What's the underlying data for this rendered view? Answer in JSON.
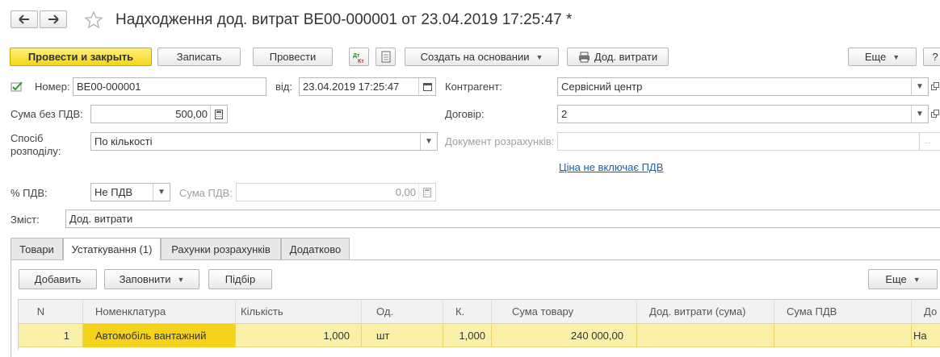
{
  "title": "Надходження дод. витрат ВЕ00-000001 от 23.04.2019 17:25:47 *",
  "toolbar": {
    "post_close": "Провести и закрыть",
    "save": "Записать",
    "post": "Провести",
    "create_based": "Создать на основании",
    "additional_costs": "Дод. витрати",
    "more": "Еще",
    "help": "?"
  },
  "form": {
    "number_label": "Номер:",
    "number_value": "ВЕ00-000001",
    "date_label": "від:",
    "date_value": "23.04.2019 17:25:47",
    "contractor_label": "Контрагент:",
    "contractor_value": "Сервісний центр",
    "amount_label": "Сума без ПДВ:",
    "amount_value": "500,00",
    "contract_label": "Договір:",
    "contract_value": "2",
    "distribution_label_1": "Спосіб",
    "distribution_label_2": "розподілу:",
    "distribution_value": "По кількості",
    "settlement_doc_label": "Документ розрахунків:",
    "settlement_doc_value": "",
    "price_link": "Ціна не включає ПДВ",
    "vat_rate_label": "% ПДВ:",
    "vat_rate_value": "Не ПДВ",
    "vat_amount_label": "Сума ПДВ:",
    "vat_amount_value": "0,00",
    "content_label": "Зміст:",
    "content_value": "Дод. витрати"
  },
  "tabs": [
    "Товари",
    "Устаткування (1)",
    "Рахунки розрахунків",
    "Додатково"
  ],
  "table_toolbar": {
    "add": "Добавить",
    "fill": "Заповнити",
    "pick": "Підбір",
    "more": "Еще"
  },
  "table": {
    "columns": [
      "N",
      "Номенклатура",
      "Кількість",
      "Од.",
      "К.",
      "Сума товару",
      "Дод. витрати (сума)",
      "Сума ПДВ",
      "До"
    ],
    "rows": [
      [
        "1",
        "Автомобіль вантажний",
        "1,000",
        "шт",
        "1,000",
        "240 000,00",
        "",
        "",
        "На"
      ]
    ]
  },
  "colors": {
    "accent_yellow": "#f4d41c",
    "row_highlight": "#fbf0a8",
    "link": "#1a5fa8"
  }
}
